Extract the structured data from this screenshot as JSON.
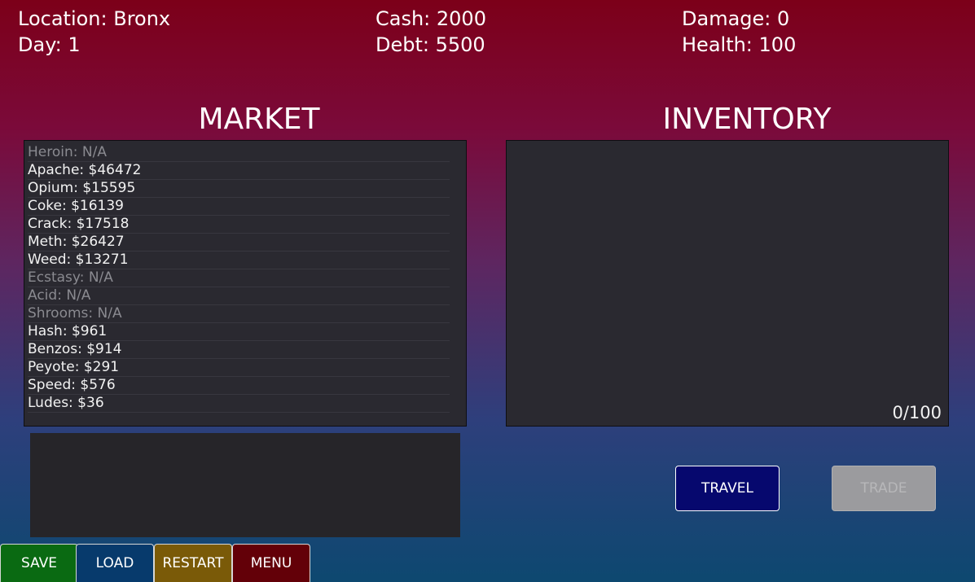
{
  "status": {
    "location": "Location: Bronx",
    "day": "Day: 1",
    "cash": "Cash: 2000",
    "debt": "Debt: 5500",
    "damage": "Damage: 0",
    "health": "Health: 100"
  },
  "market": {
    "title": "MARKET",
    "items": [
      {
        "label": "Heroin: N/A",
        "available": false
      },
      {
        "label": "Apache: $46472",
        "available": true
      },
      {
        "label": "Opium: $15595",
        "available": true
      },
      {
        "label": "Coke: $16139",
        "available": true
      },
      {
        "label": "Crack: $17518",
        "available": true
      },
      {
        "label": "Meth: $26427",
        "available": true
      },
      {
        "label": "Weed: $13271",
        "available": true
      },
      {
        "label": "Ecstasy: N/A",
        "available": false
      },
      {
        "label": "Acid: N/A",
        "available": false
      },
      {
        "label": "Shrooms: N/A",
        "available": false
      },
      {
        "label": "Hash: $961",
        "available": true
      },
      {
        "label": "Benzos: $914",
        "available": true
      },
      {
        "label": "Peyote: $291",
        "available": true
      },
      {
        "label": "Speed: $576",
        "available": true
      },
      {
        "label": "Ludes: $36",
        "available": true
      }
    ]
  },
  "inventory": {
    "title": "INVENTORY",
    "capacity": "0/100"
  },
  "actions": {
    "travel": "TRAVEL",
    "trade": "TRADE",
    "trade_enabled": false
  },
  "bottom_bar": {
    "save": "SAVE",
    "load": "LOAD",
    "restart": "RESTART",
    "menu": "MENU"
  },
  "colors": {
    "background_top": "#7c0019",
    "background_bottom": "#0d4870",
    "panel": "#2a2930",
    "travel_button": "#06086e",
    "trade_button_disabled": "#9b9b9e",
    "save_button": "#0a6a12",
    "load_button": "#073a6c",
    "restart_button": "#7a5a08",
    "menu_button": "#630008",
    "unavailable_text": "#8a8a90"
  }
}
